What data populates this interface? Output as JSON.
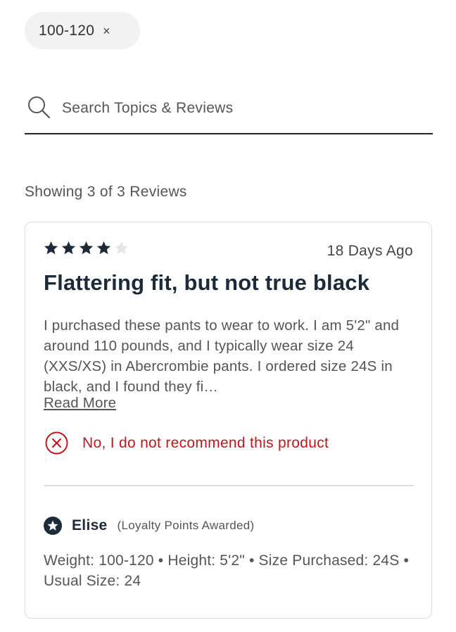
{
  "filter_chip": {
    "label": "100-120",
    "close_glyph": "×"
  },
  "search": {
    "placeholder": "Search Topics & Reviews",
    "value": "",
    "icon": "search-icon"
  },
  "results": {
    "summary": "Showing 3 of 3 Reviews"
  },
  "review": {
    "rating": 4,
    "rating_max": 5,
    "date": "18 Days Ago",
    "title": "Flattering fit, but not true black",
    "body": "I purchased these pants to wear to work. I am 5'2\" and around 110 pounds, and I typically wear size 24 (XXS/XS) in Abercrombie pants. I ordered size 24S in black, and I found they fi…",
    "read_more": "Read More",
    "recommendation": "No, I do not recommend this product",
    "reviewer": {
      "name": "Elise",
      "badge": "(Loyalty Points Awarded)",
      "icon": "star-badge-icon"
    },
    "details": "Weight: 100-120 • Height: 5'2\" • Size Purchased: 24S • Usual Size: 24"
  },
  "colors": {
    "star_filled": "#1d2a3a",
    "star_empty": "#e6e6e6",
    "not_recommend": "#c0161c",
    "title": "#1d2a3a",
    "chip_bg": "#f2f2f3"
  }
}
